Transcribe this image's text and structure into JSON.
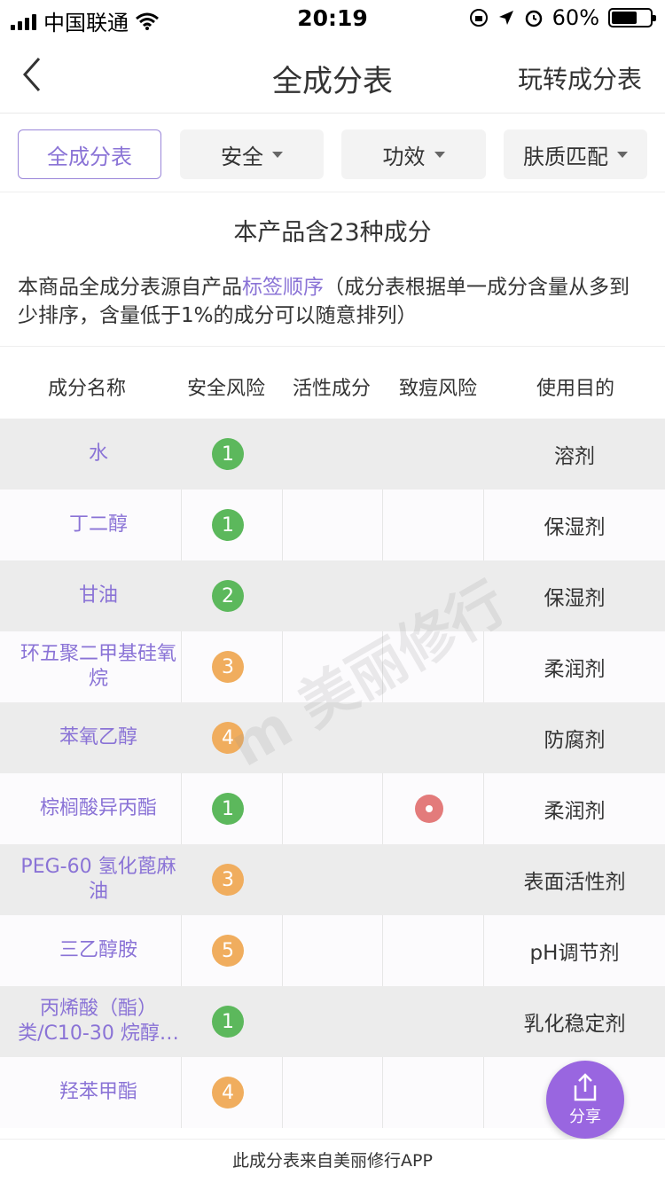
{
  "status_bar": {
    "carrier": "中国联通",
    "time": "20:19",
    "battery": "60%",
    "battery_level": 0.6
  },
  "nav": {
    "title": "全成分表",
    "right_link": "玩转成分表"
  },
  "filters": [
    {
      "label": "全成分表",
      "active": true
    },
    {
      "label": "安全",
      "active": false
    },
    {
      "label": "功效",
      "active": false
    },
    {
      "label": "肤质匹配",
      "active": false
    }
  ],
  "summary": {
    "count_text": "本产品含23种成分",
    "desc_prefix": "本商品全成分表源自产品",
    "desc_link": "标签顺序",
    "desc_suffix": "（成分表根据单一成分含量从多到少排序，含量低于1%的成分可以随意排列）"
  },
  "table": {
    "headers": [
      "成分名称",
      "安全风险",
      "活性成分",
      "致痘风险",
      "使用目的"
    ],
    "rows": [
      {
        "name": "水",
        "safety": "1",
        "acne": false,
        "purpose": "溶剂"
      },
      {
        "name": "丁二醇",
        "safety": "1",
        "acne": false,
        "purpose": "保湿剂"
      },
      {
        "name": "甘油",
        "safety": "2",
        "acne": false,
        "purpose": "保湿剂"
      },
      {
        "name": "环五聚二甲基硅氧烷",
        "safety": "3",
        "acne": false,
        "purpose": "柔润剂"
      },
      {
        "name": "苯氧乙醇",
        "safety": "4",
        "acne": false,
        "purpose": "防腐剂"
      },
      {
        "name": "棕榈酸异丙酯",
        "safety": "1",
        "acne": true,
        "purpose": "柔润剂"
      },
      {
        "name": "PEG-60 氢化蓖麻油",
        "safety": "3",
        "acne": false,
        "purpose": "表面活性剂"
      },
      {
        "name": "三乙醇胺",
        "safety": "5",
        "acne": false,
        "purpose": "pH调节剂"
      },
      {
        "name": "丙烯酸（酯）类/C10-30 烷醇…",
        "safety": "1",
        "acne": false,
        "purpose": "乳化稳定剂"
      },
      {
        "name": "羟苯甲酯",
        "safety": "4",
        "acne": false,
        "purpose": ""
      }
    ]
  },
  "colors": {
    "accent": "#8a73d6",
    "safe": "#5cb85c",
    "moderate": "#f0ad5e",
    "acne": "#e37b7b",
    "fab": "#9966e0"
  },
  "fab": {
    "label": "分享"
  },
  "footer": "此成分表来自美丽修行APP",
  "watermark": "m 美丽修行"
}
